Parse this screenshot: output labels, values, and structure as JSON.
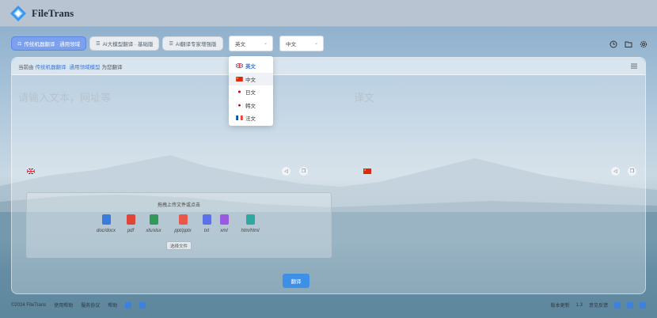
{
  "app": {
    "title": "FileTrans"
  },
  "modes": [
    {
      "label": "传统机器翻译 · 通用领域",
      "active": true
    },
    {
      "label": "AI大模型翻译 · 基础版",
      "active": false
    },
    {
      "label": "AI翻译专家增强版",
      "active": false
    }
  ],
  "source_lang": {
    "value": "英文"
  },
  "target_lang": {
    "value": "中文"
  },
  "dropdown": {
    "options": [
      "英文",
      "中文",
      "日文",
      "韩文",
      "法文"
    ],
    "selected": "英文",
    "hovered": "中文"
  },
  "hint": {
    "prefix": "当前由",
    "engine": "传统机器翻译",
    "model": "通用领域模型",
    "suffix": "为您翻译"
  },
  "source": {
    "placeholder": "请输入文本，网址等"
  },
  "target": {
    "placeholder": "译文"
  },
  "upload": {
    "title": "拖拽上传文件或点击",
    "types": [
      "doc/docx",
      "pdf",
      "xls/xlsx",
      "ppt/pptx",
      "txt",
      "xml",
      "htm/html"
    ],
    "choose_label": "选择文件"
  },
  "translate_label": "翻译",
  "footer": {
    "copyright": "©2024 FileTrans",
    "links": [
      "使用帮助",
      "服务协议",
      "帮助"
    ],
    "version_label": "版本更新",
    "version": "1.3",
    "feedback": "意见反馈"
  },
  "colors": {
    "accent": "#3e8fe6",
    "link": "#3d78d8",
    "header": "#b8c4d1"
  }
}
